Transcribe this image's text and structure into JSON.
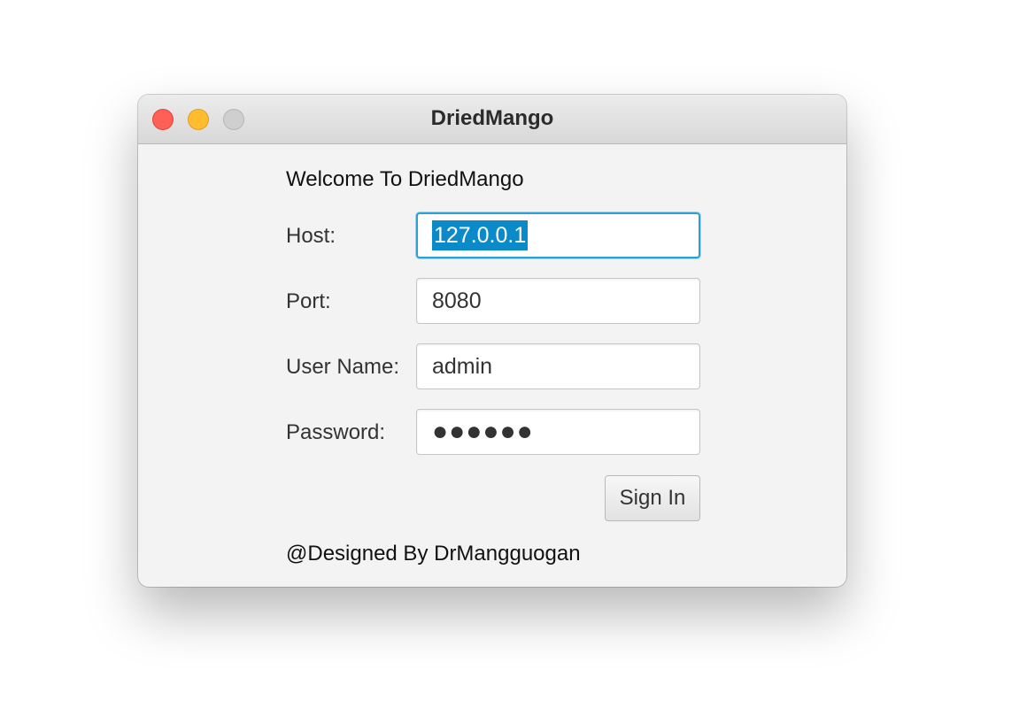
{
  "window": {
    "title": "DriedMango"
  },
  "form": {
    "welcome": "Welcome To DriedMango",
    "host_label": "Host:",
    "host_value": "127.0.0.1",
    "port_label": "Port:",
    "port_value": "8080",
    "username_label": "User Name:",
    "username_value": "admin",
    "password_label": "Password:",
    "password_mask": "●●●●●●",
    "signin_label": "Sign In",
    "footer": "@Designed By DrMangguogan"
  },
  "colors": {
    "focus_border": "#2aa0d8",
    "selection": "#0a8ac9",
    "close": "#fe5f57",
    "minimize": "#febc2e",
    "maximize": "#cfcfcf"
  }
}
